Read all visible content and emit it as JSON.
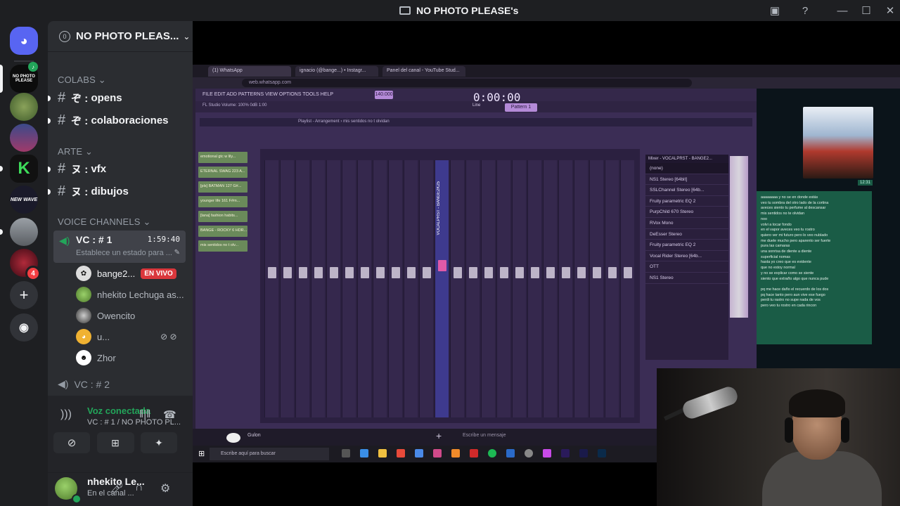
{
  "window": {
    "title": "NO PHOTO PLEASE's"
  },
  "server": {
    "name": "NO PHOTO PLEAS...",
    "boost_count": "0",
    "categories": [
      {
        "label": "COLABS",
        "channels": [
          {
            "prefix": "ぞ :",
            "name": "opens"
          },
          {
            "prefix": "ぞ :",
            "name": "colaboraciones"
          }
        ]
      },
      {
        "label": "ARTE",
        "channels": [
          {
            "prefix": "ヌ :",
            "name": "vfx"
          },
          {
            "prefix": "ヌ :",
            "name": "dibujos"
          }
        ]
      },
      {
        "label": "VOICE CHANNELS",
        "channels": []
      }
    ]
  },
  "rail": {
    "servers": [
      {
        "name": "NO PHOTO PLEASE",
        "label": "NO PHOTO PLEASE"
      },
      {
        "name": "server-green-avatar"
      },
      {
        "name": "server-night-sky"
      },
      {
        "name": "server-k-logo",
        "label": "K"
      },
      {
        "name": "server-new-wave",
        "label": "NEW WAVE"
      },
      {
        "name": "server-gray"
      },
      {
        "name": "server-red",
        "badge": "4"
      }
    ]
  },
  "voice": {
    "active_channel": "VC : # 1",
    "timer": "1:59:40",
    "status_placeholder": "Establece un estado para ...",
    "members": [
      {
        "name": "bange2...",
        "live": "EN VIVO"
      },
      {
        "name": "nhekito Lechuga as..."
      },
      {
        "name": "Owencito"
      },
      {
        "name": "u..."
      },
      {
        "name": "Zhor"
      }
    ],
    "other_channel": "VC : # 2"
  },
  "voice_panel": {
    "title": "Voz conectada",
    "subtitle": "VC : # 1 / NO PHOTO PL..."
  },
  "user": {
    "name": "nhekito Le...",
    "status": "En el canal ..."
  },
  "stream": {
    "tabs": [
      "(1) WhatsApp",
      "ignacio (@bange...) • Instagr...",
      "Panel del canal - YouTube Stud..."
    ],
    "url": "web.whatsapp.com",
    "fl_menu": "FILE  EDIT  ADD  PATTERNS  VIEW  OPTIONS  TOOLS  HELP",
    "fl_time": "0:00:00",
    "fl_bpm": "140.000",
    "fl_pattern": "Pattern 1",
    "fl_line": "Line",
    "fl_info": "FL Studio  Volume: 100%  0dB  1:00",
    "playlist_title": "Playlist - Arrangement › mis sentidos no t olvidan",
    "tracks": [
      "emotional gtc w lily...",
      "ETERNAL SWAG 223 A...",
      "[pls] BATMAN 127 G#...",
      "younger life 161 F#m...",
      "[lana] fashion habits...",
      "BANGE - ROCKY 6 HDR...",
      "mis sentidos no t olv..."
    ],
    "mixer_title": "Mixer - VOCALPRST - BANGE2...",
    "mixer_selected": "VOCALPRST - BANGE2K25",
    "fx": [
      "(none)",
      "NS1 Stereo [64bit]",
      "SSLChannel Stereo [64b...",
      "Fruity parametric EQ 2",
      "PurpChild 670 Stereo",
      "RVox Mono",
      "DeEsser Stereo",
      "Fruity parametric EQ 2",
      "Vocal Rider Stereo [64b...",
      "OTT",
      "NS1 Stereo"
    ],
    "chat_time": "12:31",
    "chat_lines": [
      "aaaaaaaa y no se en donde estás",
      "veo tu sombra del otro lado de la cortina",
      "aveces siento tu perfume al descansar",
      "mis sentidos no te olvidan",
      "noo",
      "volvi a tocar fondo",
      "en el vapor aveces veo tu rostro",
      "quiero ver mi futuro pero lo veo nublado",
      "me duele mucho pero aparento ser fuerte",
      "pura las camaras",
      "una sonrisa de diente a diente",
      "superficial nomas",
      "hasta yo creo que es evidente",
      "que no estoy normal",
      "y no se explicar como se siente",
      "siento que extraño algo que nunca pude",
      "",
      "pq me hace daño el recuerdo de los dos",
      "pq hace tanto pero aun vive ese fuego",
      "perdi tu rastro no supe nada de vos",
      "pero veo tu rostro en cada rincon"
    ],
    "chat_placeholder": "Escribe un mensaje",
    "contact_label": "Gulon",
    "taskbar_search": "Escribe aquí para buscar"
  }
}
